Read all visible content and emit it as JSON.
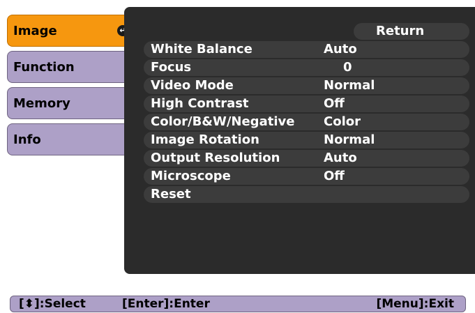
{
  "tabs": [
    {
      "label": "Image",
      "active": true
    },
    {
      "label": "Function",
      "active": false
    },
    {
      "label": "Memory",
      "active": false
    },
    {
      "label": "Info",
      "active": false
    }
  ],
  "active_tab_icon": "enter-icon",
  "return_label": "Return",
  "settings": [
    {
      "label": "White Balance",
      "value": "Auto"
    },
    {
      "label": "Focus",
      "value": "0"
    },
    {
      "label": "Video Mode",
      "value": "Normal"
    },
    {
      "label": "High Contrast",
      "value": "Off"
    },
    {
      "label": "Color/B&W/Negative",
      "value": "Color"
    },
    {
      "label": "Image Rotation",
      "value": "Normal"
    },
    {
      "label": "Output Resolution",
      "value": "Auto"
    },
    {
      "label": "Microscope",
      "value": "Off"
    },
    {
      "label": "Reset",
      "value": ""
    }
  ],
  "help": {
    "select": "[⬍]:Select",
    "enter": "[Enter]:Enter",
    "exit": "[Menu]:Exit"
  },
  "colors": {
    "active_tab": "#f6970f",
    "inactive_tab": "#ada0c7",
    "panel": "#2b2b2b",
    "row": "#3c3c3c"
  }
}
